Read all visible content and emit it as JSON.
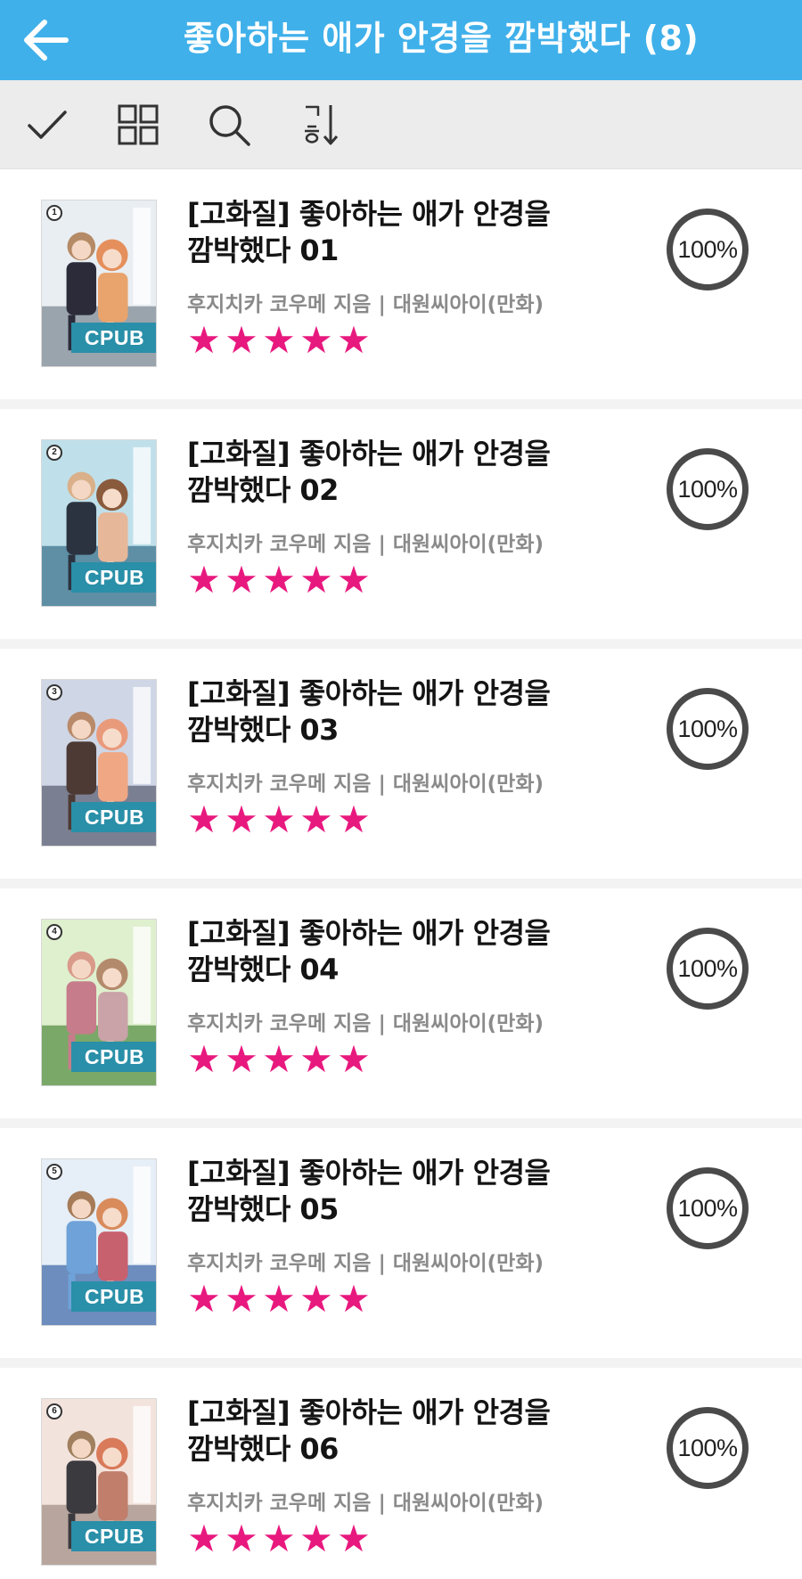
{
  "header": {
    "title": "좋아하는 애가 안경을 깜박했다 (8)"
  },
  "toolbar": {
    "buttons": [
      {
        "name": "select-button",
        "icon": "checkmark-icon"
      },
      {
        "name": "grid-view-button",
        "icon": "grid-icon"
      },
      {
        "name": "search-button",
        "icon": "search-icon"
      },
      {
        "name": "sort-button",
        "icon": "sort-korean-icon"
      }
    ]
  },
  "colors": {
    "header_bg": "#3fb0ea",
    "star": "#e8197e",
    "badge": "#2a8fa8"
  },
  "books": [
    {
      "title_line1": "[고화질] 좋아하는 애가 안경을",
      "title_line2": "깜박했다 01",
      "meta": "후지치카 코우메 지음 | 대원씨아이(만화)",
      "badge": "CPUB",
      "volume": "1",
      "stars": 5,
      "progress": "100%"
    },
    {
      "title_line1": "[고화질] 좋아하는 애가 안경을",
      "title_line2": "깜박했다 02",
      "meta": "후지치카 코우메 지음 | 대원씨아이(만화)",
      "badge": "CPUB",
      "volume": "2",
      "stars": 5,
      "progress": "100%"
    },
    {
      "title_line1": "[고화질] 좋아하는 애가 안경을",
      "title_line2": "깜박했다 03",
      "meta": "후지치카 코우메 지음 | 대원씨아이(만화)",
      "badge": "CPUB",
      "volume": "3",
      "stars": 5,
      "progress": "100%"
    },
    {
      "title_line1": "[고화질] 좋아하는 애가 안경을",
      "title_line2": "깜박했다 04",
      "meta": "후지치카 코우메 지음 | 대원씨아이(만화)",
      "badge": "CPUB",
      "volume": "4",
      "stars": 5,
      "progress": "100%"
    },
    {
      "title_line1": "[고화질] 좋아하는 애가 안경을",
      "title_line2": "깜박했다 05",
      "meta": "후지치카 코우메 지음 | 대원씨아이(만화)",
      "badge": "CPUB",
      "volume": "5",
      "stars": 5,
      "progress": "100%"
    },
    {
      "title_line1": "[고화질] 좋아하는 애가 안경을",
      "title_line2": "깜박했다 06",
      "meta": "후지치카 코우메 지음 | 대원씨아이(만화)",
      "badge": "CPUB",
      "volume": "6",
      "stars": 5,
      "progress": "100%"
    }
  ]
}
